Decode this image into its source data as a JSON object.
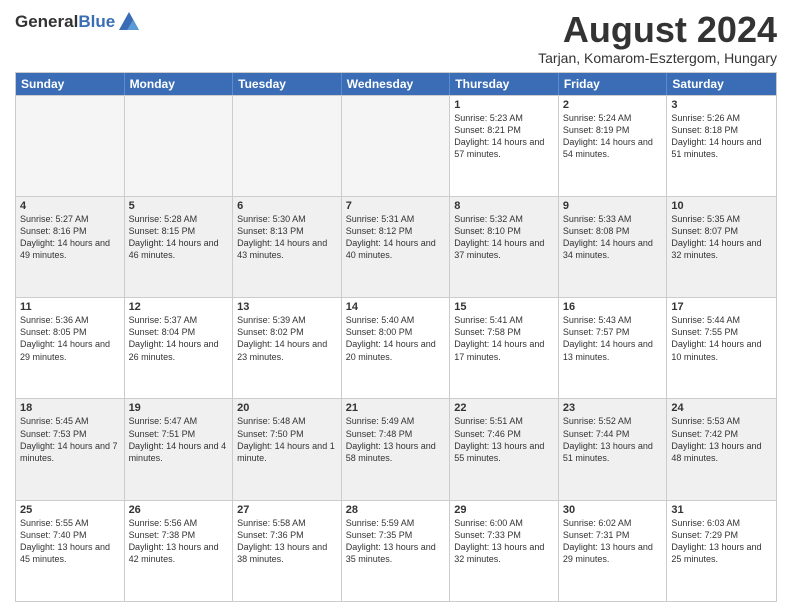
{
  "header": {
    "logo_general": "General",
    "logo_blue": "Blue",
    "month_title": "August 2024",
    "location": "Tarjan, Komarom-Esztergom, Hungary"
  },
  "weekdays": [
    "Sunday",
    "Monday",
    "Tuesday",
    "Wednesday",
    "Thursday",
    "Friday",
    "Saturday"
  ],
  "rows": [
    [
      {
        "day": "",
        "empty": true
      },
      {
        "day": "",
        "empty": true
      },
      {
        "day": "",
        "empty": true
      },
      {
        "day": "",
        "empty": true
      },
      {
        "day": "1",
        "sunrise": "5:23 AM",
        "sunset": "8:21 PM",
        "daylight": "14 hours and 57 minutes."
      },
      {
        "day": "2",
        "sunrise": "5:24 AM",
        "sunset": "8:19 PM",
        "daylight": "14 hours and 54 minutes."
      },
      {
        "day": "3",
        "sunrise": "5:26 AM",
        "sunset": "8:18 PM",
        "daylight": "14 hours and 51 minutes."
      }
    ],
    [
      {
        "day": "4",
        "sunrise": "5:27 AM",
        "sunset": "8:16 PM",
        "daylight": "14 hours and 49 minutes."
      },
      {
        "day": "5",
        "sunrise": "5:28 AM",
        "sunset": "8:15 PM",
        "daylight": "14 hours and 46 minutes."
      },
      {
        "day": "6",
        "sunrise": "5:30 AM",
        "sunset": "8:13 PM",
        "daylight": "14 hours and 43 minutes."
      },
      {
        "day": "7",
        "sunrise": "5:31 AM",
        "sunset": "8:12 PM",
        "daylight": "14 hours and 40 minutes."
      },
      {
        "day": "8",
        "sunrise": "5:32 AM",
        "sunset": "8:10 PM",
        "daylight": "14 hours and 37 minutes."
      },
      {
        "day": "9",
        "sunrise": "5:33 AM",
        "sunset": "8:08 PM",
        "daylight": "14 hours and 34 minutes."
      },
      {
        "day": "10",
        "sunrise": "5:35 AM",
        "sunset": "8:07 PM",
        "daylight": "14 hours and 32 minutes."
      }
    ],
    [
      {
        "day": "11",
        "sunrise": "5:36 AM",
        "sunset": "8:05 PM",
        "daylight": "14 hours and 29 minutes."
      },
      {
        "day": "12",
        "sunrise": "5:37 AM",
        "sunset": "8:04 PM",
        "daylight": "14 hours and 26 minutes."
      },
      {
        "day": "13",
        "sunrise": "5:39 AM",
        "sunset": "8:02 PM",
        "daylight": "14 hours and 23 minutes."
      },
      {
        "day": "14",
        "sunrise": "5:40 AM",
        "sunset": "8:00 PM",
        "daylight": "14 hours and 20 minutes."
      },
      {
        "day": "15",
        "sunrise": "5:41 AM",
        "sunset": "7:58 PM",
        "daylight": "14 hours and 17 minutes."
      },
      {
        "day": "16",
        "sunrise": "5:43 AM",
        "sunset": "7:57 PM",
        "daylight": "14 hours and 13 minutes."
      },
      {
        "day": "17",
        "sunrise": "5:44 AM",
        "sunset": "7:55 PM",
        "daylight": "14 hours and 10 minutes."
      }
    ],
    [
      {
        "day": "18",
        "sunrise": "5:45 AM",
        "sunset": "7:53 PM",
        "daylight": "14 hours and 7 minutes."
      },
      {
        "day": "19",
        "sunrise": "5:47 AM",
        "sunset": "7:51 PM",
        "daylight": "14 hours and 4 minutes."
      },
      {
        "day": "20",
        "sunrise": "5:48 AM",
        "sunset": "7:50 PM",
        "daylight": "14 hours and 1 minute."
      },
      {
        "day": "21",
        "sunrise": "5:49 AM",
        "sunset": "7:48 PM",
        "daylight": "13 hours and 58 minutes."
      },
      {
        "day": "22",
        "sunrise": "5:51 AM",
        "sunset": "7:46 PM",
        "daylight": "13 hours and 55 minutes."
      },
      {
        "day": "23",
        "sunrise": "5:52 AM",
        "sunset": "7:44 PM",
        "daylight": "13 hours and 51 minutes."
      },
      {
        "day": "24",
        "sunrise": "5:53 AM",
        "sunset": "7:42 PM",
        "daylight": "13 hours and 48 minutes."
      }
    ],
    [
      {
        "day": "25",
        "sunrise": "5:55 AM",
        "sunset": "7:40 PM",
        "daylight": "13 hours and 45 minutes."
      },
      {
        "day": "26",
        "sunrise": "5:56 AM",
        "sunset": "7:38 PM",
        "daylight": "13 hours and 42 minutes."
      },
      {
        "day": "27",
        "sunrise": "5:58 AM",
        "sunset": "7:36 PM",
        "daylight": "13 hours and 38 minutes."
      },
      {
        "day": "28",
        "sunrise": "5:59 AM",
        "sunset": "7:35 PM",
        "daylight": "13 hours and 35 minutes."
      },
      {
        "day": "29",
        "sunrise": "6:00 AM",
        "sunset": "7:33 PM",
        "daylight": "13 hours and 32 minutes."
      },
      {
        "day": "30",
        "sunrise": "6:02 AM",
        "sunset": "7:31 PM",
        "daylight": "13 hours and 29 minutes."
      },
      {
        "day": "31",
        "sunrise": "6:03 AM",
        "sunset": "7:29 PM",
        "daylight": "13 hours and 25 minutes."
      }
    ]
  ]
}
